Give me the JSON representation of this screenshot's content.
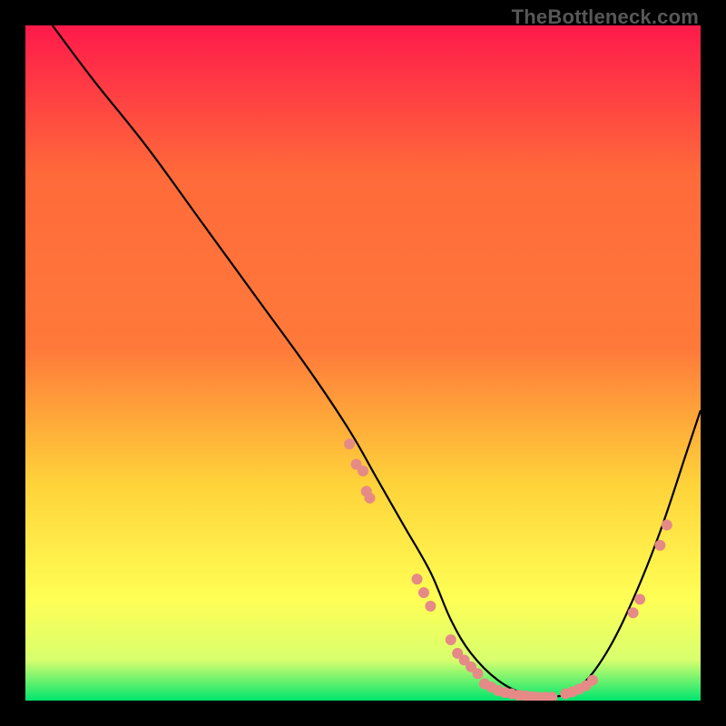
{
  "watermark": "TheBottleneck.com",
  "chart_data": {
    "type": "line",
    "title": "",
    "xlabel": "",
    "ylabel": "",
    "xlim": [
      0,
      100
    ],
    "ylim": [
      0,
      100
    ],
    "grid": false,
    "legend": false,
    "background_gradient": {
      "top": "#ff1a4b",
      "mid_upper": "#ff7a3a",
      "mid": "#ffd33a",
      "mid_lower": "#ffff55",
      "near_bottom": "#d8ff6e",
      "bottom": "#00e56e"
    },
    "series": [
      {
        "name": "curve",
        "color": "#000000",
        "x": [
          4,
          10,
          18,
          26,
          34,
          42,
          48,
          52,
          56,
          60,
          63,
          66,
          70,
          74,
          78,
          82,
          86,
          90,
          94,
          98,
          100
        ],
        "y": [
          100,
          92,
          82,
          71,
          60,
          49,
          40,
          33,
          26,
          19,
          12,
          7,
          3,
          1,
          0.5,
          2,
          7,
          15,
          25,
          37,
          43
        ]
      }
    ],
    "markers": {
      "color": "#e58a86",
      "radius": 6,
      "points": [
        {
          "x": 48,
          "y": 38
        },
        {
          "x": 49,
          "y": 35
        },
        {
          "x": 50,
          "y": 34
        },
        {
          "x": 50.5,
          "y": 31
        },
        {
          "x": 51,
          "y": 30
        },
        {
          "x": 58,
          "y": 18
        },
        {
          "x": 59,
          "y": 16
        },
        {
          "x": 60,
          "y": 14
        },
        {
          "x": 63,
          "y": 9
        },
        {
          "x": 64,
          "y": 7
        },
        {
          "x": 65,
          "y": 6
        },
        {
          "x": 66,
          "y": 5
        },
        {
          "x": 67,
          "y": 4
        },
        {
          "x": 68,
          "y": 2.5
        },
        {
          "x": 69,
          "y": 2
        },
        {
          "x": 70,
          "y": 1.5
        },
        {
          "x": 71,
          "y": 1.2
        },
        {
          "x": 72,
          "y": 1
        },
        {
          "x": 73,
          "y": 0.8
        },
        {
          "x": 74,
          "y": 0.7
        },
        {
          "x": 75,
          "y": 0.6
        },
        {
          "x": 76,
          "y": 0.5
        },
        {
          "x": 77,
          "y": 0.5
        },
        {
          "x": 78,
          "y": 0.5
        },
        {
          "x": 80,
          "y": 1
        },
        {
          "x": 81,
          "y": 1.3
        },
        {
          "x": 82,
          "y": 1.7
        },
        {
          "x": 83,
          "y": 2.2
        },
        {
          "x": 84,
          "y": 3
        },
        {
          "x": 90,
          "y": 13
        },
        {
          "x": 91,
          "y": 15
        },
        {
          "x": 94,
          "y": 23
        },
        {
          "x": 95,
          "y": 26
        }
      ]
    }
  }
}
